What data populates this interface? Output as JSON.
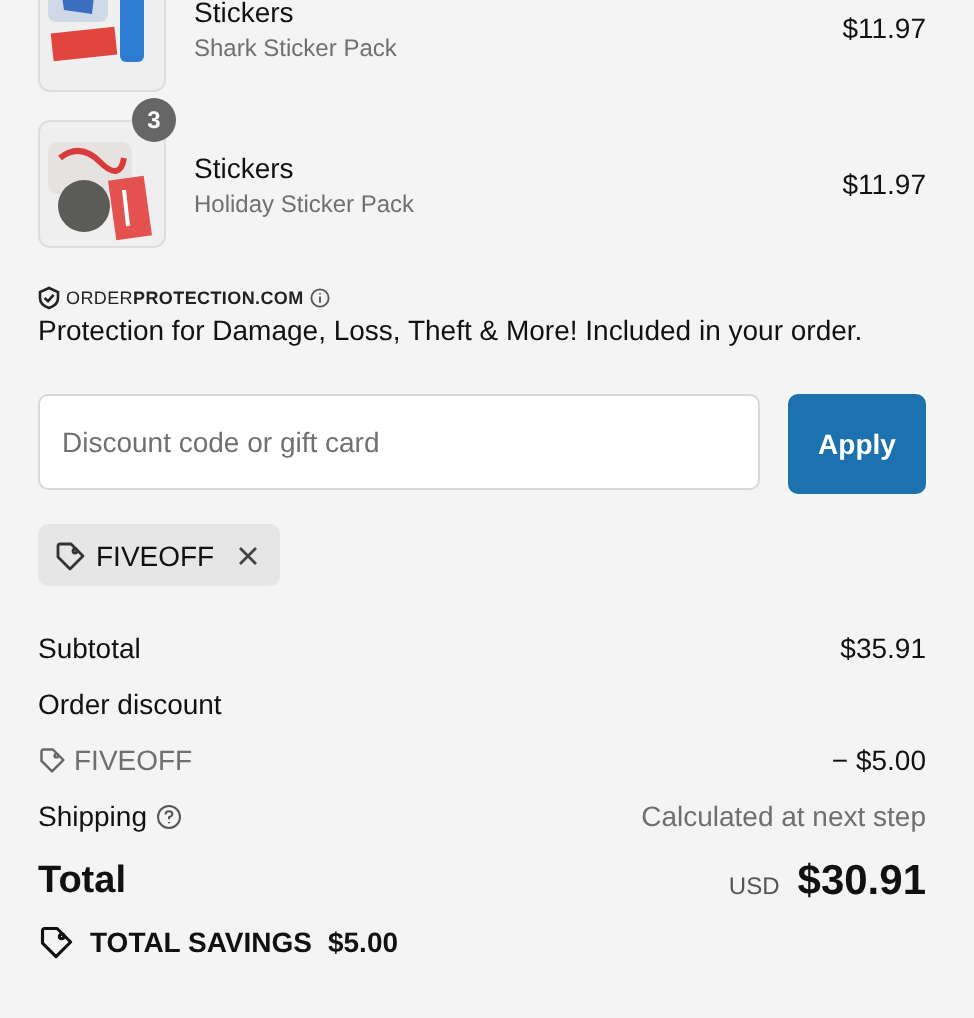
{
  "items": [
    {
      "title": "Stickers",
      "variant": "Shark Sticker Pack",
      "price": "$11.97"
    },
    {
      "title": "Stickers",
      "variant": "Holiday Sticker Pack",
      "price": "$11.97",
      "quantity": "3"
    }
  ],
  "protection": {
    "logo": "ORDER**PROTECTION.COM**",
    "text": "Protection for Damage, Loss, Theft & More! Included in your order."
  },
  "discount": {
    "placeholder": "Discount code or gift card",
    "button": "Apply",
    "applied_code": "FIVEOFF"
  },
  "summary": [
    {
      "kind": "line",
      "label": "Subtotal",
      "value": "$35.91"
    },
    {
      "kind": "heading",
      "label": "Order discount"
    },
    {
      "kind": "code",
      "label": "FIVEOFF",
      "value": "− $5.00"
    },
    {
      "kind": "help",
      "label": "Shipping",
      "value": "Calculated at next step",
      "muted": true
    }
  ],
  "total": {
    "label": "Total",
    "currency": "USD",
    "value": "$30.91"
  },
  "savings": {
    "label": "TOTAL SAVINGS",
    "value": "$5.00"
  }
}
